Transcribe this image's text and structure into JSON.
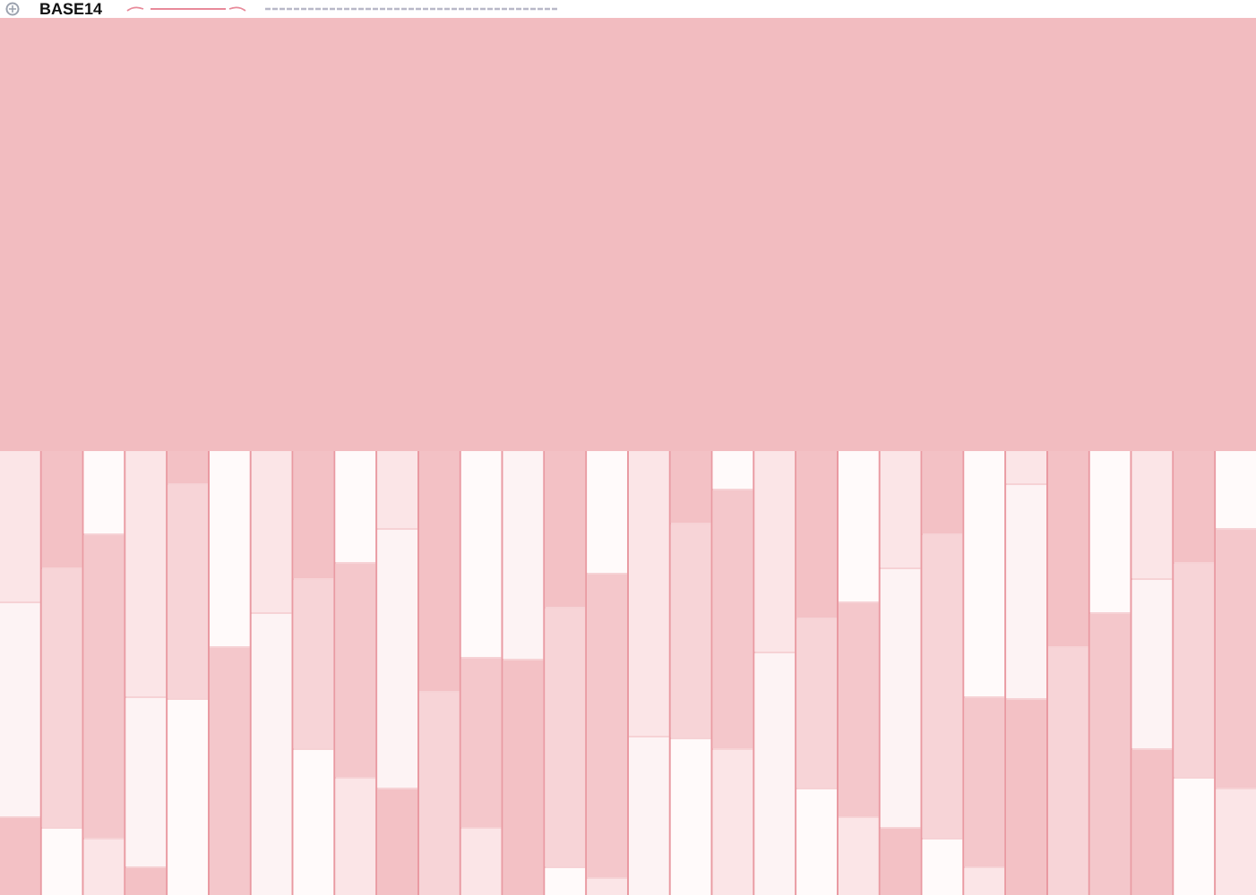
{
  "header": {
    "code": "BASE14"
  }
}
